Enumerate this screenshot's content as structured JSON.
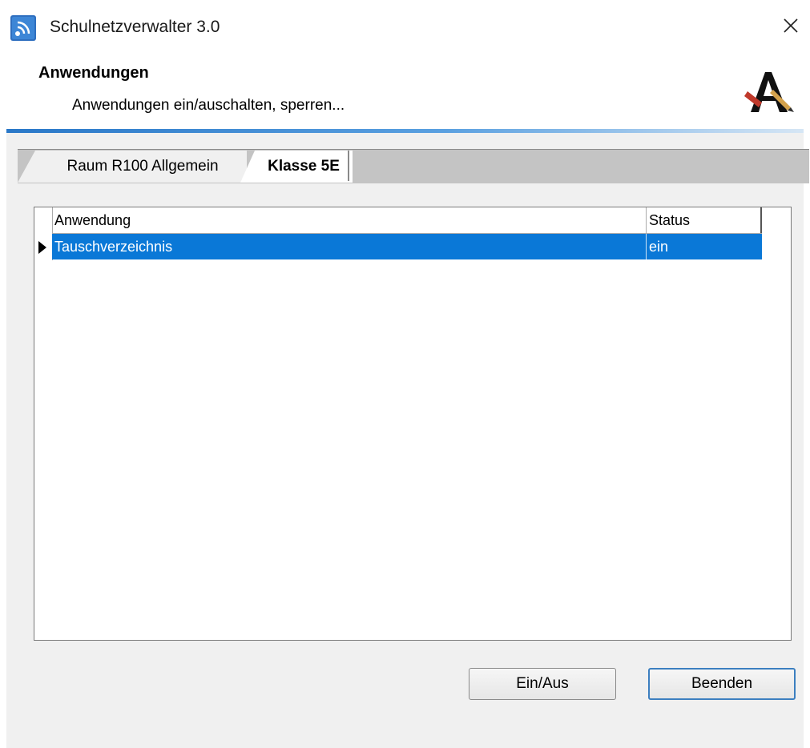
{
  "window": {
    "title": "Schulnetzverwalter 3.0",
    "close_symbol": "✕"
  },
  "header": {
    "title": "Anwendungen",
    "subtitle": "Anwendungen ein/auschalten, sperren..."
  },
  "tabs": [
    {
      "label": "Raum R100 Allgemein",
      "active": false
    },
    {
      "label": "Klasse 5E",
      "active": true
    }
  ],
  "grid": {
    "columns": [
      "Anwendung",
      "Status"
    ],
    "rows": [
      {
        "anwendung": "Tauschverzeichnis",
        "status": "ein",
        "selected": true
      }
    ]
  },
  "buttons": {
    "toggle_label": "Ein/Aus",
    "close_label": "Beenden"
  },
  "colors": {
    "selection": "#0a78d7",
    "accent_rule": "#2a78c8"
  }
}
